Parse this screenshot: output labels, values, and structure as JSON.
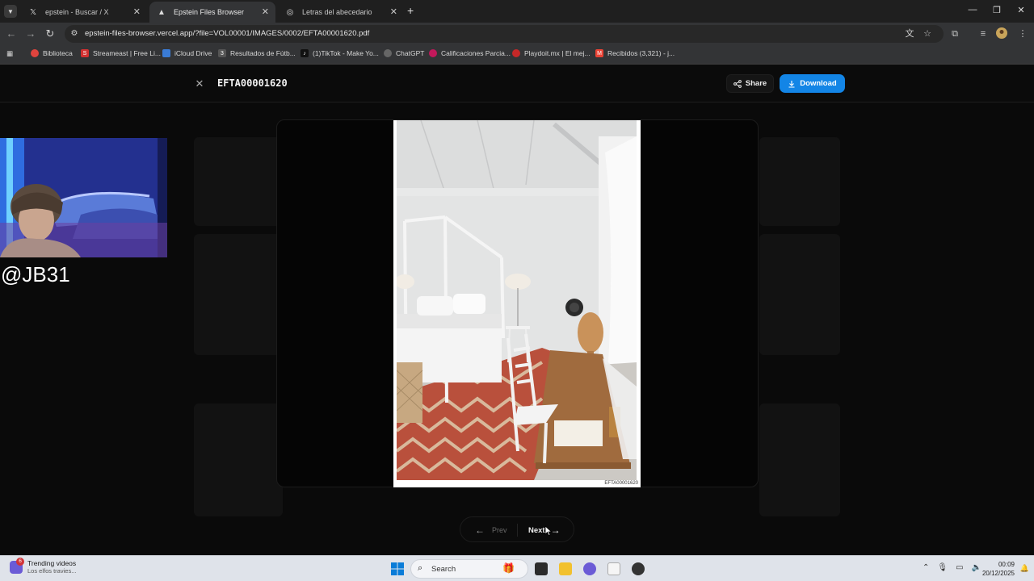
{
  "tabs": [
    {
      "title": "epstein - Buscar / X",
      "icon": "x-logo-icon"
    },
    {
      "title": "Epstein Files Browser",
      "icon": "vercel-triangle-icon",
      "active": true
    },
    {
      "title": "Letras del abecedario",
      "icon": "globe-icon"
    }
  ],
  "address_bar": {
    "url": "epstein-files-browser.vercel.app/?file=VOL00001/IMAGES/0002/EFTA00001620.pdf"
  },
  "bookmarks": [
    {
      "label": "Biblioteca",
      "color": "#e0443e"
    },
    {
      "label": "Streameast | Free Li...",
      "color": "#d33030"
    },
    {
      "label": "iCloud Drive",
      "color": "#3a7bd5"
    },
    {
      "label": "Resultados de Fútb...",
      "color": "#555555"
    },
    {
      "label": "(1)TikTok - Make Yo...",
      "color": "#111111"
    },
    {
      "label": "ChatGPT",
      "color": "#666666"
    },
    {
      "label": "Calificaciones Parcia...",
      "color": "#c2185b"
    },
    {
      "label": "Playdoit.mx | El mej...",
      "color": "#c62828"
    },
    {
      "label": "Recibidos (3,321) - j...",
      "color": "#ea4335"
    }
  ],
  "viewer": {
    "file_title": "EFTA00001620",
    "share_label": "Share",
    "download_label": "Download",
    "doc_label": "EFTA00001620",
    "prev_label": "Prev",
    "next_label": "Next"
  },
  "overlay": {
    "handle": "@JB31"
  },
  "taskbar": {
    "widget_badge": "6",
    "widget_title": "Trending videos",
    "widget_subtitle": "Los elfos travies...",
    "search_placeholder": "Search",
    "time": "00:09",
    "date": "20/12/2025"
  },
  "colors": {
    "accent": "#1385e6",
    "page_bg": "#0a0a0a"
  }
}
